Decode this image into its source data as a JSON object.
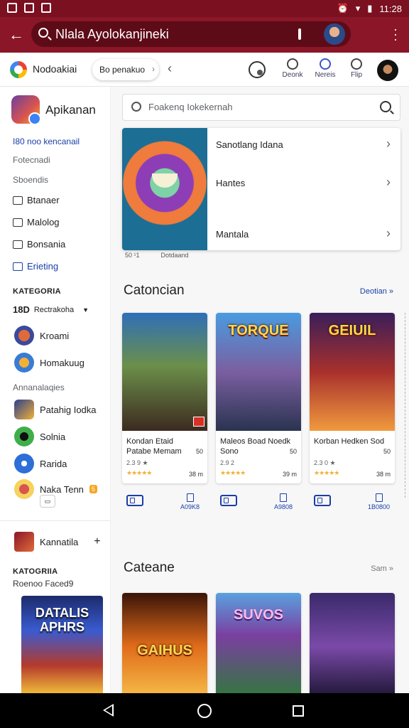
{
  "status": {
    "time": "11:28"
  },
  "urlbar": {
    "text": "Nlala Ayolokanjineki"
  },
  "toolbar": {
    "title": "Nodoakiai",
    "chip": "Bo penakuo",
    "actions": [
      "Deonk",
      "Nereis",
      "Flip"
    ]
  },
  "sidebar": {
    "app_title": "Apikanan",
    "link": "I80 noo kencanail",
    "sub1": "Fotecnadi",
    "sub2": "Sboendis",
    "nav": [
      "Btanaer",
      "Malolog",
      "Bonsania",
      "Erieting"
    ],
    "cat_head": "KATEGORIA",
    "cat_first_num": "18D",
    "cat_first_label": "Rectrakoha",
    "games1": [
      "Kroami",
      "Homakuug"
    ],
    "sub3": "Annanalaqies",
    "games2": [
      "Patahig Iodka",
      "Solnia",
      "Rarida",
      "Naka Tenn"
    ],
    "badge": "5",
    "small_btn": "▭",
    "kannatila": "Kannatila",
    "plus": "+",
    "cat2_head": "KATOGRIIA",
    "cat2_sub": "Roenoo Faced9",
    "poster_title": "DATALIS APHRS"
  },
  "main": {
    "search_placeholder": "Foakenq Iokekernah",
    "feature_rows": [
      "Sanotlang Idana",
      "Hantes",
      "Mantala"
    ],
    "feature_sub": [
      "50 ¹1",
      "Dotdaand"
    ],
    "sec1_title": "Catoncian",
    "sec1_link": "Deotian »",
    "sec2_title": "Cateane",
    "sec2_link": "Sam »",
    "cards1": [
      {
        "name": "Kondan Etaid Patabe Memam",
        "meta": "50",
        "rate": "2.3 9 ★",
        "stars": "★★★★★",
        "size": "38 m",
        "art_title": ""
      },
      {
        "name": "Maleos Boad Noedk Sono",
        "meta": "50",
        "rate": "2.9 2",
        "stars": "★★★★★",
        "size": "39 m",
        "art_title": "TORQUE"
      },
      {
        "name": "Korban Hedken Sod",
        "meta": "50",
        "rate": "2.3 0 ★",
        "stars": "★★★★★",
        "size": "38 m",
        "art_title": "GEIUIL"
      }
    ],
    "actions1": [
      "A09K8",
      "A9808"
    ],
    "action_extra": "1B0800",
    "cards2_titles": [
      "GAIHUS",
      "SUVOS",
      ""
    ]
  }
}
